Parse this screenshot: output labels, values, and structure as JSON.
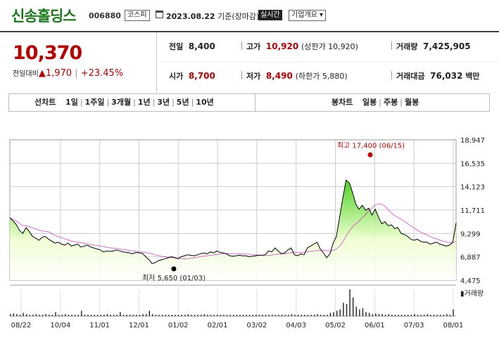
{
  "header": {
    "company_name": "신송홀딩스",
    "code": "006880",
    "market": "코스피",
    "date": "2023.08.22",
    "date_suffix": "기준(장마감)",
    "realtime_label": "실시간",
    "company_overview_label": "기업개요 ▾"
  },
  "quote": {
    "price": "10,370",
    "change_label": "전일대비",
    "change_arrow": "▲",
    "change_value": "1,970",
    "change_pct": "+23.45%",
    "prev_close_label": "전일",
    "prev_close": "8,400",
    "high_label": "고가",
    "high": "10,920",
    "upper_limit_text": "(상한가 10,920)",
    "volume_label": "거래량",
    "volume": "7,425,905",
    "open_label": "시가",
    "open": "8,700",
    "low_label": "저가",
    "low": "8,490",
    "lower_limit_text": "(하한가 5,880)",
    "amount_label": "거래대금",
    "amount": "76,032",
    "amount_unit": "백만"
  },
  "tabs": {
    "line_chart_label": "선차트",
    "line_periods": [
      "1일",
      "1주일",
      "3개월",
      "1년",
      "3년",
      "5년",
      "10년"
    ],
    "candle_chart_label": "봉차트",
    "candle_periods": [
      "일봉",
      "주봉",
      "월봉"
    ]
  },
  "chart_data": {
    "type": "area",
    "y_ticks": [
      "18,947",
      "16,535",
      "14,123",
      "11,711",
      "9,299",
      "6,887",
      "4,475"
    ],
    "ylim": [
      4475,
      18947
    ],
    "x_ticks": [
      "08/22",
      "10/04",
      "11/01",
      "12/01",
      "01/02",
      "02/01",
      "03/02",
      "04/03",
      "05/02",
      "06/01",
      "07/03",
      "08/01"
    ],
    "high_annotation": "최고 17,400 (06/15)",
    "low_annotation": "최저 5,650 (01/03)",
    "volume_label": "거래량",
    "colors": {
      "line": "#000000",
      "fill_top": "#33cc00",
      "ma": "#cc00cc",
      "marker": "#cc0000",
      "grid": "#cccccc"
    },
    "prices": [
      10900,
      10600,
      10200,
      9600,
      9300,
      9900,
      9500,
      9000,
      8800,
      8600,
      8900,
      9000,
      8700,
      8500,
      8300,
      8400,
      8200,
      8100,
      8300,
      8000,
      8100,
      8200,
      7900,
      8000,
      8100,
      7900,
      7800,
      7700,
      7600,
      7400,
      7500,
      7450,
      7500,
      7600,
      7500,
      7400,
      7350,
      7300,
      7200,
      7350,
      7300,
      7250,
      6900,
      6600,
      6200,
      6300,
      6500,
      6600,
      6700,
      6800,
      6900,
      6800,
      6700,
      6900,
      7000,
      7100,
      7050,
      7000,
      7100,
      7200,
      7300,
      7200,
      7400,
      7300,
      7500,
      7350,
      7300,
      7200,
      7000,
      6950,
      7000,
      7050,
      7000,
      7000,
      6900,
      6950,
      7000,
      7050,
      7050,
      7100,
      7500,
      7400,
      7800,
      7500,
      7200,
      7300,
      7600,
      7800,
      7100,
      7000,
      7200,
      7100,
      7800,
      8000,
      8200,
      8400,
      7700,
      7300,
      6800,
      7200,
      8300,
      9000,
      11000,
      13000,
      14800,
      14500,
      13500,
      12300,
      11800,
      12200,
      11700,
      11900,
      11200,
      11800,
      11000,
      10300,
      10500,
      10100,
      10200,
      9800,
      9900,
      9300,
      9200,
      9000,
      8700,
      8600,
      8700,
      8500,
      8400,
      8400,
      8200,
      8300,
      8400,
      8200,
      8100,
      8000,
      8100,
      8400,
      10370
    ],
    "volume": [
      3,
      4,
      3,
      2,
      5,
      3,
      2,
      2,
      3,
      2,
      2,
      3,
      2,
      2,
      6,
      2,
      2,
      3,
      2,
      2,
      2,
      2,
      8,
      2,
      2,
      2,
      2,
      2,
      2,
      2,
      3,
      2,
      2,
      2,
      6,
      2,
      2,
      2,
      2,
      2,
      2,
      3,
      3,
      8,
      3,
      2,
      2,
      2,
      2,
      2,
      2,
      2,
      2,
      2,
      2,
      3,
      2,
      2,
      2,
      2,
      3,
      2,
      2,
      2,
      2,
      2,
      2,
      2,
      2,
      2,
      2,
      2,
      2,
      2,
      2,
      2,
      2,
      2,
      2,
      2,
      2,
      2,
      2,
      2,
      2,
      2,
      2,
      3,
      2,
      2,
      2,
      2,
      2,
      2,
      2,
      3,
      2,
      2,
      2,
      5,
      6,
      8,
      10,
      20,
      18,
      40,
      28,
      14,
      10,
      12,
      6,
      5,
      3,
      4,
      3,
      3,
      2,
      3,
      2,
      2,
      2,
      2,
      2,
      2,
      2,
      3,
      2,
      2,
      2,
      3,
      2,
      2,
      2,
      2,
      2,
      3,
      2,
      10
    ]
  }
}
